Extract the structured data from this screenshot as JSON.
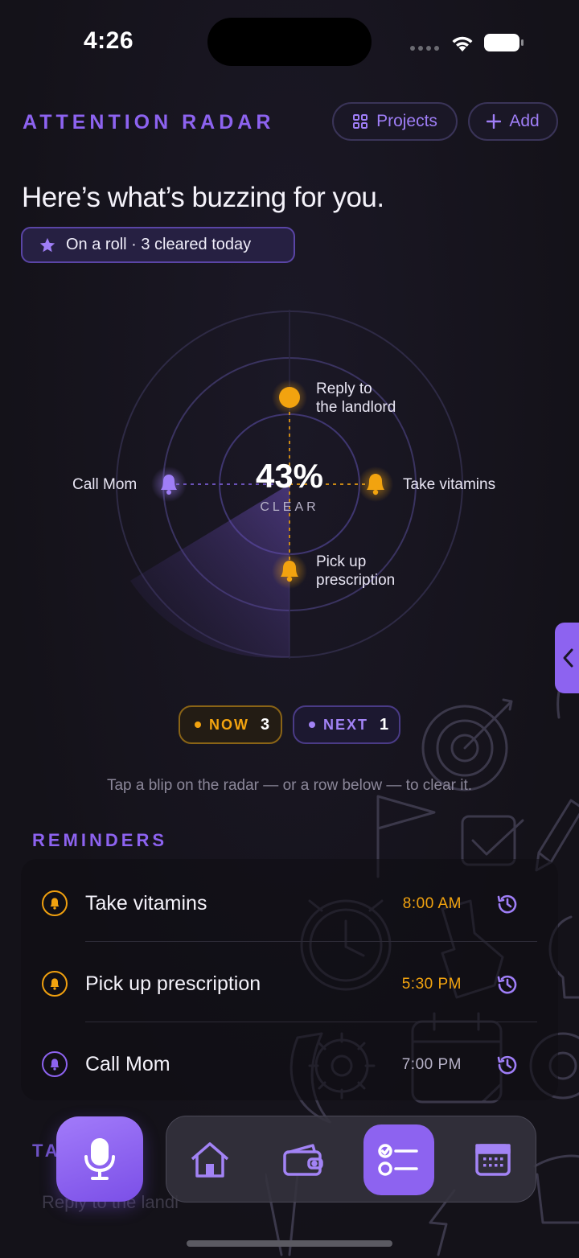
{
  "status_bar": {
    "time": "4:26"
  },
  "header": {
    "title": "ATTENTION RADAR",
    "projects_label": "Projects",
    "add_label": "Add"
  },
  "headline": "Here’s what’s buzzing for you.",
  "streak": {
    "text": "On a roll · 3 cleared today"
  },
  "radar": {
    "percent": "43%",
    "percent_caption": "CLEAR",
    "blips": [
      {
        "label_line1": "Reply to",
        "label_line2": "the landlord",
        "status": "now"
      },
      {
        "label": "Take vitamins",
        "status": "now"
      },
      {
        "label_line1": "Pick up",
        "label_line2": "prescription",
        "status": "now"
      },
      {
        "label": "Call Mom",
        "status": "next"
      }
    ]
  },
  "filters": {
    "now": {
      "label": "NOW",
      "count": "3"
    },
    "next": {
      "label": "NEXT",
      "count": "1"
    }
  },
  "hint": "Tap a blip on the radar — or a row below — to clear it.",
  "reminders": {
    "section_title": "REMINDERS",
    "items": [
      {
        "title": "Take vitamins",
        "time": "8:00 AM",
        "status": "now"
      },
      {
        "title": "Pick up prescription",
        "time": "5:30 PM",
        "status": "now"
      },
      {
        "title": "Call Mom",
        "time": "7:00 PM",
        "status": "next"
      }
    ]
  },
  "tasks": {
    "section_title_partial": "TA",
    "first_item_partial": "Reply to the landl"
  },
  "tab_bar": {
    "items": [
      {
        "name": "home",
        "icon": "home-icon"
      },
      {
        "name": "wallet",
        "icon": "wallet-icon"
      },
      {
        "name": "tasks",
        "icon": "checklist-icon",
        "active": true
      },
      {
        "name": "calendar",
        "icon": "calendar-icon"
      }
    ]
  },
  "colors": {
    "accent_purple": "#8d63f0",
    "accent_amber": "#f2a30f",
    "background": "#15131c"
  }
}
